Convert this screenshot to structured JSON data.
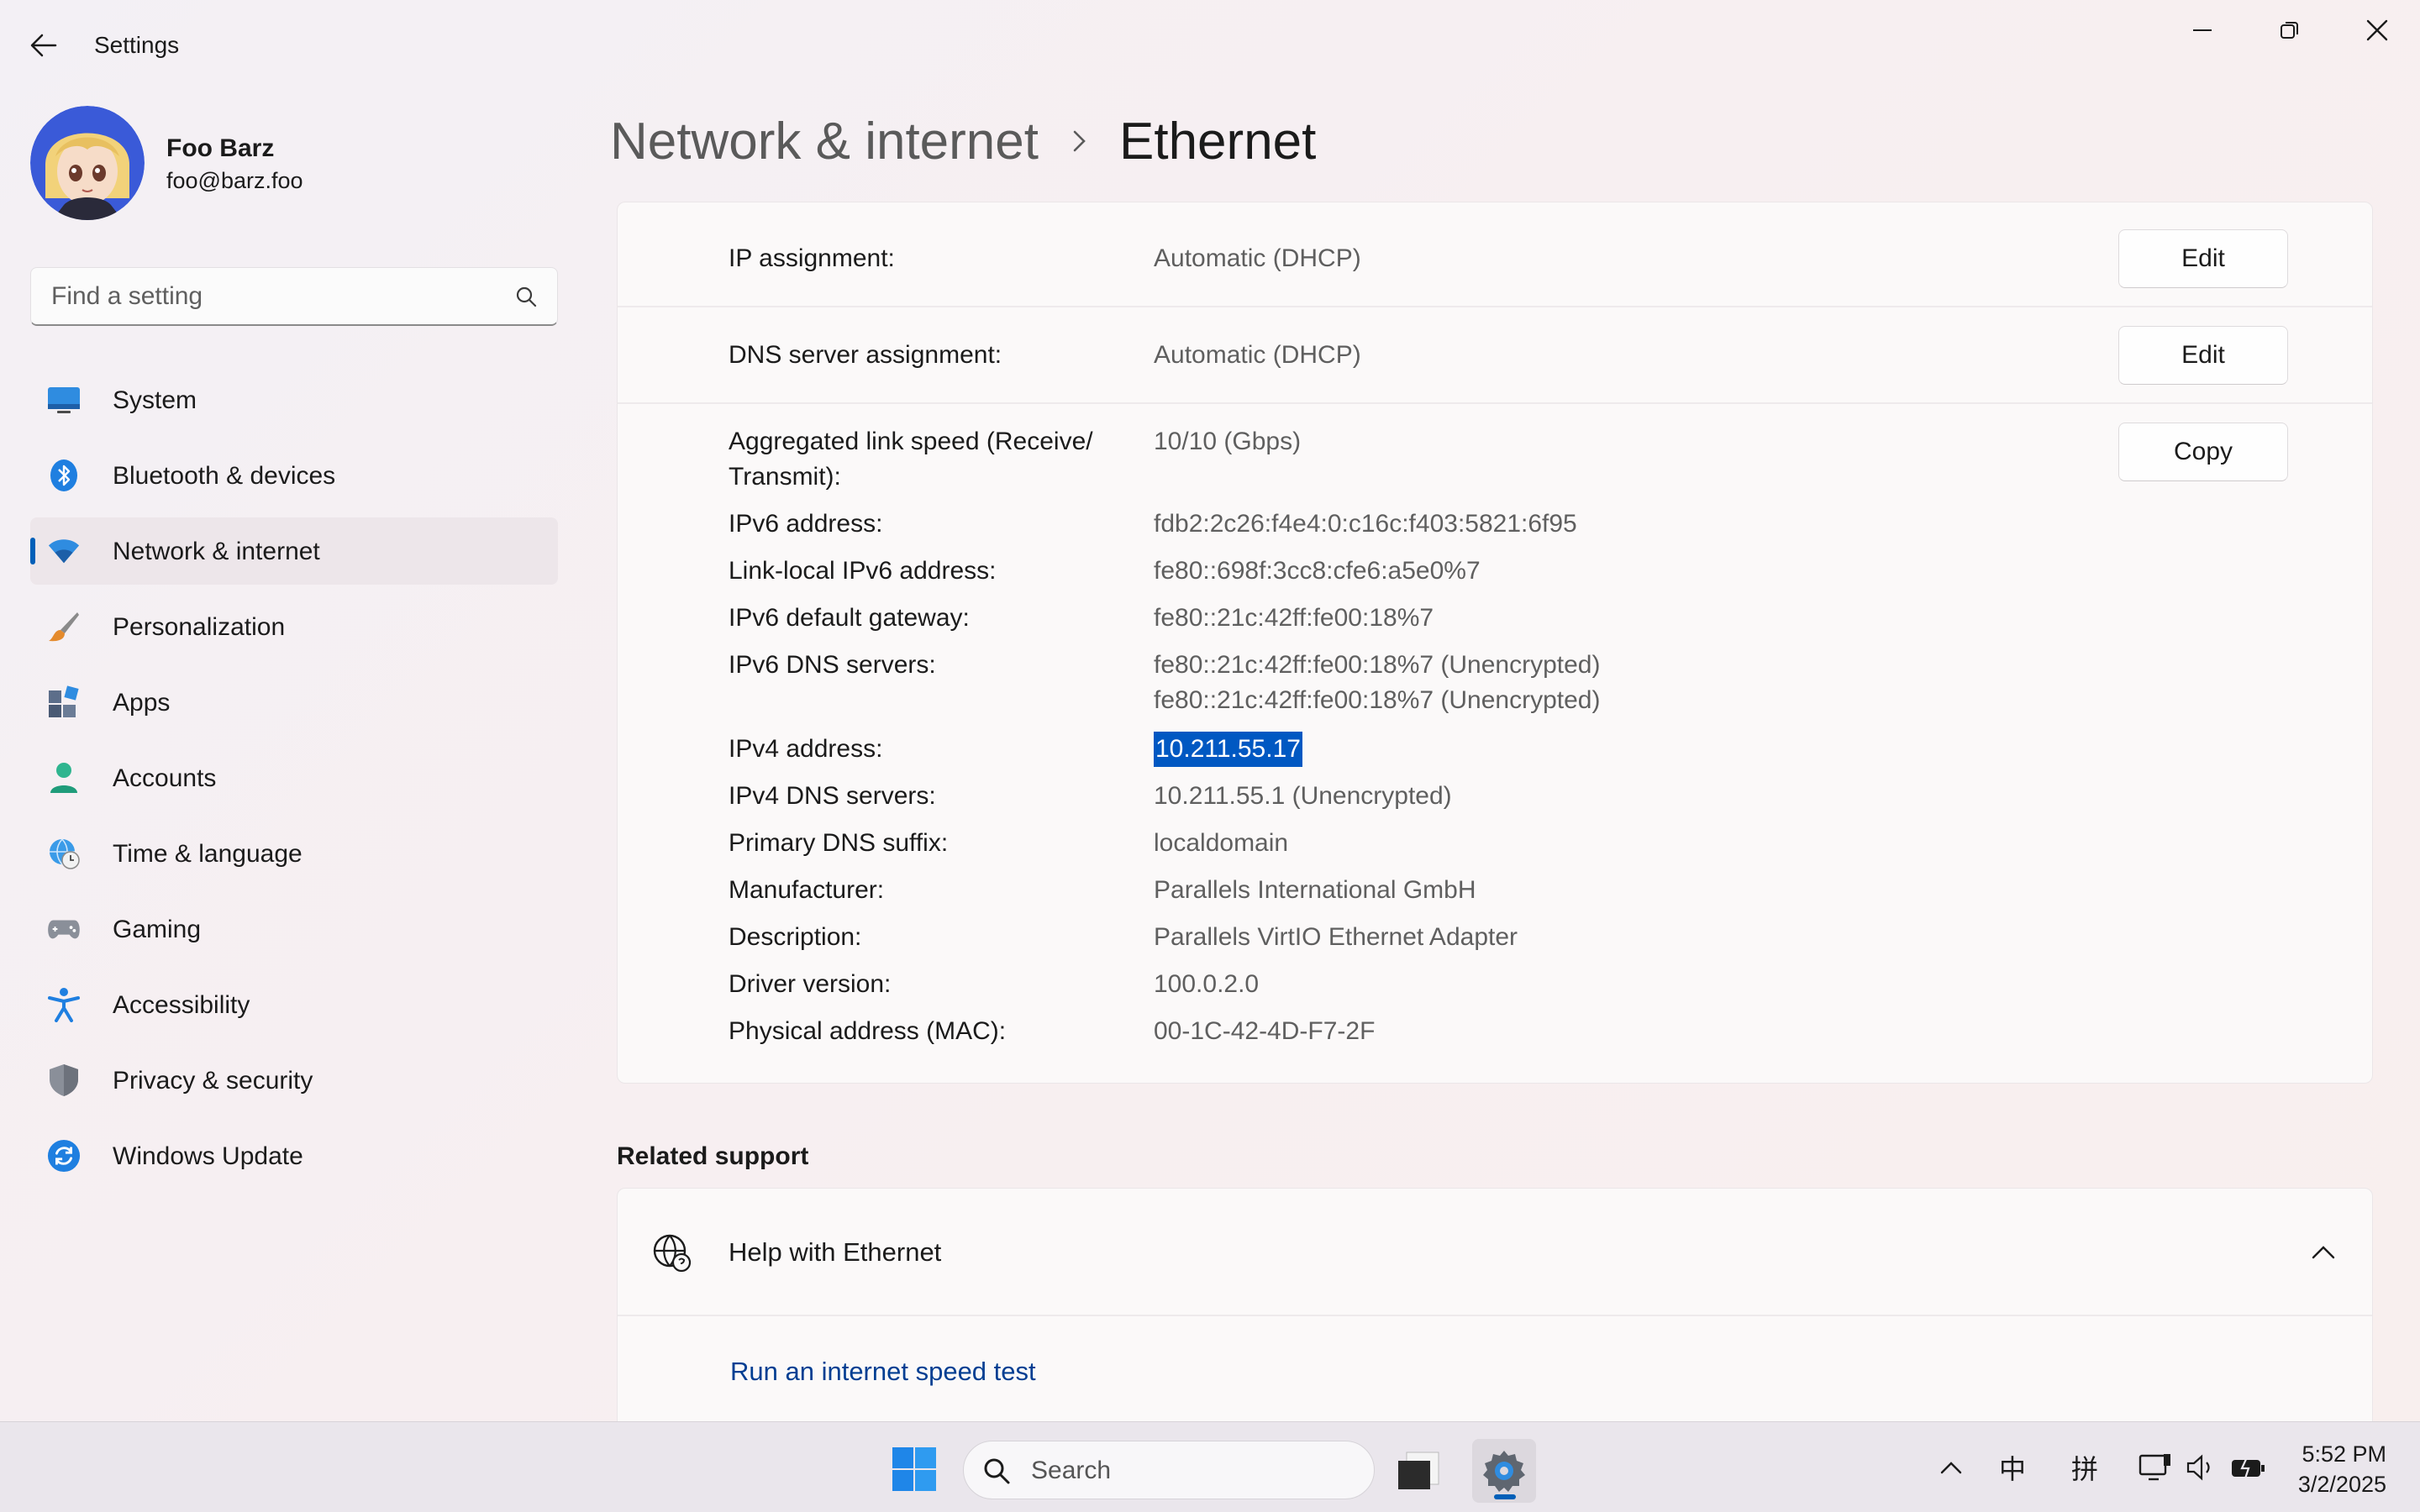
{
  "window": {
    "title": "Settings"
  },
  "profile": {
    "name": "Foo Barz",
    "email": "foo@barz.foo"
  },
  "search": {
    "placeholder": "Find a setting"
  },
  "nav": {
    "items": [
      {
        "label": "System",
        "icon": "system-icon"
      },
      {
        "label": "Bluetooth & devices",
        "icon": "bluetooth-icon"
      },
      {
        "label": "Network & internet",
        "icon": "wifi-icon",
        "active": true
      },
      {
        "label": "Personalization",
        "icon": "brush-icon"
      },
      {
        "label": "Apps",
        "icon": "apps-icon"
      },
      {
        "label": "Accounts",
        "icon": "person-icon"
      },
      {
        "label": "Time & language",
        "icon": "globe-clock-icon"
      },
      {
        "label": "Gaming",
        "icon": "gamepad-icon"
      },
      {
        "label": "Accessibility",
        "icon": "accessibility-icon"
      },
      {
        "label": "Privacy & security",
        "icon": "shield-icon"
      },
      {
        "label": "Windows Update",
        "icon": "update-icon"
      }
    ]
  },
  "breadcrumb": {
    "parent": "Network & internet",
    "current": "Ethernet"
  },
  "settings": {
    "ip_assignment": {
      "label": "IP assignment:",
      "value": "Automatic (DHCP)",
      "button": "Edit"
    },
    "dns_assignment": {
      "label": "DNS server assignment:",
      "value": "Automatic (DHCP)",
      "button": "Edit"
    },
    "copy_button": "Copy",
    "details": [
      {
        "label": "Aggregated link speed (Receive/ Transmit):",
        "value": "10/10 (Gbps)"
      },
      {
        "label": "IPv6 address:",
        "value": "fdb2:2c26:f4e4:0:c16c:f403:5821:6f95"
      },
      {
        "label": "Link-local IPv6 address:",
        "value": "fe80::698f:3cc8:cfe6:a5e0%7"
      },
      {
        "label": "IPv6 default gateway:",
        "value": "fe80::21c:42ff:fe00:18%7"
      },
      {
        "label": "IPv6 DNS servers:",
        "value": "fe80::21c:42ff:fe00:18%7 (Unencrypted)",
        "value2": "fe80::21c:42ff:fe00:18%7 (Unencrypted)"
      },
      {
        "label": "IPv4 address:",
        "value": "10.211.55.17",
        "selected": true
      },
      {
        "label": "IPv4 DNS servers:",
        "value": "10.211.55.1 (Unencrypted)"
      },
      {
        "label": "Primary DNS suffix:",
        "value": "localdomain"
      },
      {
        "label": "Manufacturer:",
        "value": "Parallels International GmbH"
      },
      {
        "label": "Description:",
        "value": "Parallels VirtIO Ethernet Adapter"
      },
      {
        "label": "Driver version:",
        "value": "100.0.2.0"
      },
      {
        "label": "Physical address (MAC):",
        "value": "00-1C-42-4D-F7-2F"
      }
    ]
  },
  "related": {
    "title": "Related support",
    "help_label": "Help with Ethernet",
    "link": "Run an internet speed test"
  },
  "taskbar": {
    "search_label": "Search",
    "ime_1": "中",
    "ime_2": "拼",
    "time": "5:52 PM",
    "date": "3/2/2025",
    "accent": "#005fb8"
  }
}
